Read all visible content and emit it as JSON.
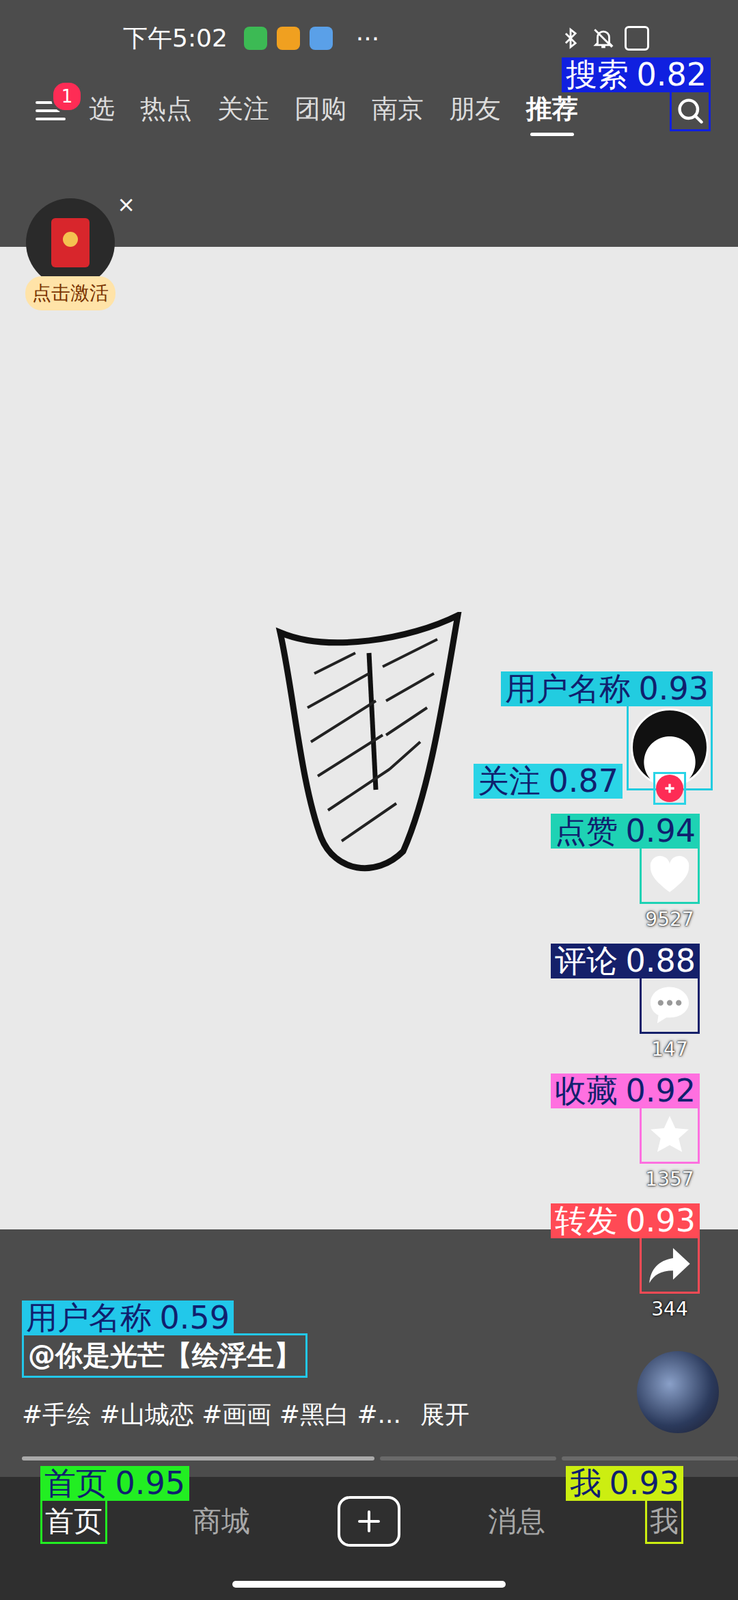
{
  "status_bar": {
    "time": "下午5:02",
    "more": "···"
  },
  "menu": {
    "badge": "1"
  },
  "tabs": [
    {
      "label": "选",
      "selected": false
    },
    {
      "label": "热点",
      "selected": false
    },
    {
      "label": "关注",
      "selected": false
    },
    {
      "label": "团购",
      "selected": false
    },
    {
      "label": "南京",
      "selected": false
    },
    {
      "label": "朋友",
      "selected": false
    },
    {
      "label": "推荐",
      "selected": true
    }
  ],
  "search": {
    "annotation": {
      "label": "搜索",
      "score": "0.82",
      "color": "#1020e0",
      "text_color": "#ffffff"
    }
  },
  "red_packet": {
    "label": "点击激活",
    "close": "×"
  },
  "author": {
    "annotation": {
      "label": "用户名称",
      "score": "0.93",
      "color": "#22cce0",
      "text_color": "#10206e"
    },
    "follow": {
      "followed": false,
      "annotation": {
        "label": "关注",
        "score": "0.87",
        "color": "#2ad4e6",
        "text_color": "#10206e"
      }
    }
  },
  "actions": [
    {
      "kind": "like",
      "count": "9527",
      "annotation": {
        "label": "点赞",
        "score": "0.94",
        "color": "#1ed2b4",
        "text_color": "#10206e"
      }
    },
    {
      "kind": "comment",
      "count": "147",
      "annotation": {
        "label": "评论",
        "score": "0.88",
        "color": "#15206a",
        "text_color": "#ffffff"
      }
    },
    {
      "kind": "collect",
      "count": "1357",
      "annotation": {
        "label": "收藏",
        "score": "0.92",
        "color": "#ff70e0",
        "text_color": "#10206e"
      }
    },
    {
      "kind": "share",
      "count": "344",
      "annotation": {
        "label": "转发",
        "score": "0.93",
        "color": "#ff4a55",
        "text_color": "#ffffff"
      }
    }
  ],
  "post": {
    "username": "@你是光芒【绘浮生】",
    "annotation": {
      "label": "用户名称",
      "score": "0.59",
      "color": "#22c8ea",
      "text_color": "#10206e"
    },
    "tags": "#手绘 #山城恋 #画画 #黑白 #...",
    "expand": "展开"
  },
  "progress": [
    {
      "level": 1
    },
    {
      "level": 0
    },
    {
      "level": 0
    }
  ],
  "bottom_nav": [
    {
      "kind": "tab",
      "label": "首页",
      "selected": true,
      "annotation": {
        "label": "首页",
        "score": "0.95",
        "color": "#22ee22",
        "text_color": "#10206e"
      }
    },
    {
      "kind": "tab",
      "label": "商城",
      "selected": false
    },
    {
      "kind": "add",
      "selected": false
    },
    {
      "kind": "tab",
      "label": "消息",
      "selected": false
    },
    {
      "kind": "tab",
      "label": "我",
      "selected": false,
      "annotation": {
        "label": "我",
        "score": "0.93",
        "color": "#ccee11",
        "text_color": "#10206e"
      }
    }
  ]
}
